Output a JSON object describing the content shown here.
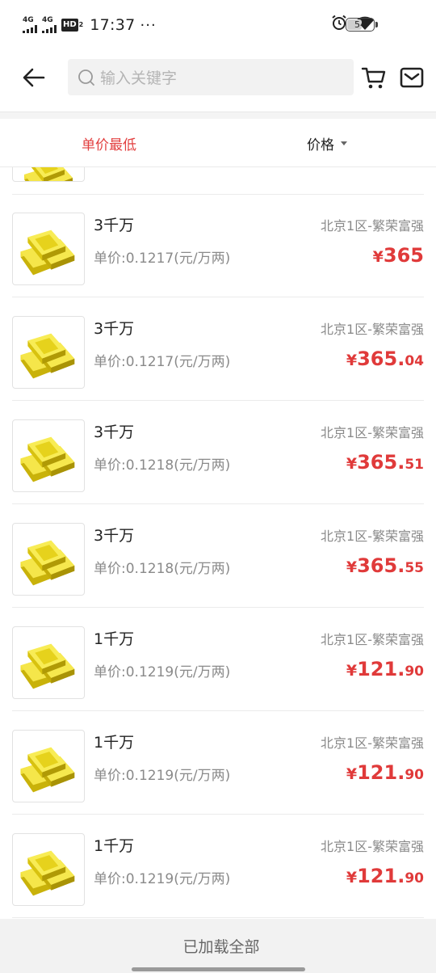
{
  "status_bar": {
    "signal1": "4G",
    "signal2": "4G",
    "hd_label": "HD",
    "hd_sub": "2",
    "time": "17:37",
    "more": "···",
    "battery": "54"
  },
  "header": {
    "search_placeholder": "输入关键字"
  },
  "sort": {
    "lowest_unit_price": "单价最低",
    "price": "价格",
    "active_color": "#e23f3f"
  },
  "items": [
    {
      "title": "3千万",
      "unit_price": "单价:0.1217(元/万两)",
      "server": "北京1区-繁荣富强",
      "price_symbol": "¥",
      "price_int": "365",
      "price_dec": ""
    },
    {
      "title": "3千万",
      "unit_price": "单价:0.1217(元/万两)",
      "server": "北京1区-繁荣富强",
      "price_symbol": "¥",
      "price_int": "365.",
      "price_dec": "04"
    },
    {
      "title": "3千万",
      "unit_price": "单价:0.1218(元/万两)",
      "server": "北京1区-繁荣富强",
      "price_symbol": "¥",
      "price_int": "365.",
      "price_dec": "51"
    },
    {
      "title": "3千万",
      "unit_price": "单价:0.1218(元/万两)",
      "server": "北京1区-繁荣富强",
      "price_symbol": "¥",
      "price_int": "365.",
      "price_dec": "55"
    },
    {
      "title": "1千万",
      "unit_price": "单价:0.1219(元/万两)",
      "server": "北京1区-繁荣富强",
      "price_symbol": "¥",
      "price_int": "121.",
      "price_dec": "90"
    },
    {
      "title": "1千万",
      "unit_price": "单价:0.1219(元/万两)",
      "server": "北京1区-繁荣富强",
      "price_symbol": "¥",
      "price_int": "121.",
      "price_dec": "90"
    },
    {
      "title": "1千万",
      "unit_price": "单价:0.1219(元/万两)",
      "server": "北京1区-繁荣富强",
      "price_symbol": "¥",
      "price_int": "121.",
      "price_dec": "90"
    }
  ],
  "footer": {
    "loaded_all": "已加载全部"
  },
  "colors": {
    "price": "#e03a3a",
    "gold": "#e8d21a"
  }
}
